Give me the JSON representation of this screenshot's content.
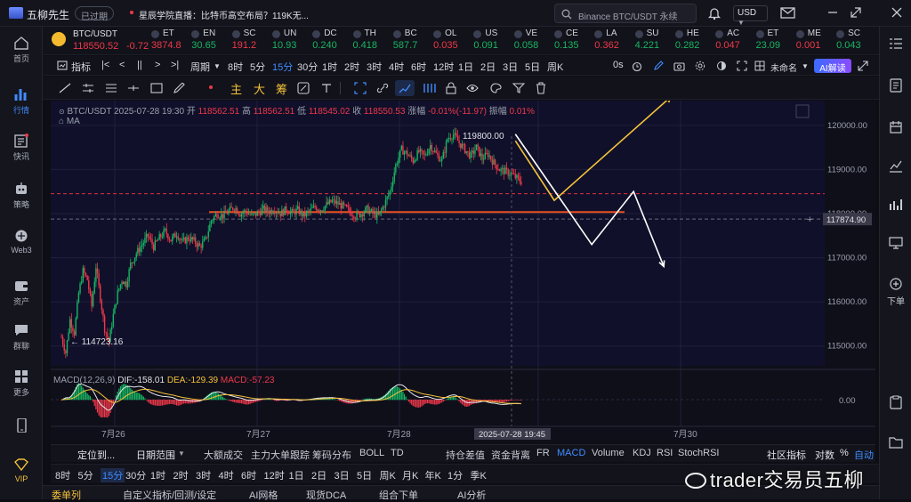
{
  "app": {
    "title": "五柳先生",
    "status_badge": "已过期",
    "announcement": "星辰学院直播：比特币高空布局？119K无...",
    "search_placeholder": "Binance BTC/USDT 永续",
    "currency": "USD"
  },
  "left_nav": [
    {
      "label": "首页",
      "icon": "home-icon"
    },
    {
      "label": "行情",
      "icon": "chart-bars-icon",
      "active": true
    },
    {
      "label": "快讯",
      "icon": "news-icon"
    },
    {
      "label": "策略",
      "icon": "robot-icon"
    },
    {
      "label": "Web3",
      "icon": "web3-icon"
    },
    {
      "label": "资产",
      "icon": "wallet-icon"
    },
    {
      "label": "群聊",
      "icon": "chat-icon"
    },
    {
      "label": "更多",
      "icon": "grid-icon"
    },
    {
      "label": "",
      "icon": "phone-icon"
    },
    {
      "label": "VIP",
      "icon": "vip-icon"
    }
  ],
  "right_nav": {
    "download_label": "下单"
  },
  "ticker_strip": {
    "main": {
      "symbol": "BTC/USDT",
      "price": "118550.52",
      "change": "-0.72"
    },
    "items": [
      {
        "name": "ET",
        "value": "3874.8"
      },
      {
        "name": "EN",
        "value": "30.65"
      },
      {
        "name": "SC",
        "value": "191.2"
      },
      {
        "name": "UN",
        "value": "10.93"
      },
      {
        "name": "DC",
        "value": "0.240"
      },
      {
        "name": "TH",
        "value": "0.418"
      },
      {
        "name": "BC",
        "value": "587.7"
      },
      {
        "name": "OL",
        "value": "0.035"
      },
      {
        "name": "US",
        "value": "0.091"
      },
      {
        "name": "VE",
        "value": "0.058"
      },
      {
        "name": "CE",
        "value": "0.135"
      },
      {
        "name": "LA",
        "value": "0.362"
      },
      {
        "name": "SU",
        "value": "4.221"
      },
      {
        "name": "HE",
        "value": "0.282"
      },
      {
        "name": "AC",
        "value": "0.047"
      },
      {
        "name": "ET",
        "value": "23.09"
      },
      {
        "name": "ME",
        "value": "0.001"
      },
      {
        "name": "SC",
        "value": "0.043"
      }
    ]
  },
  "toolbar_periods": {
    "indicator_label": "指标",
    "period_label": "周期",
    "periods": [
      "8时",
      "5分",
      "15分",
      "30分",
      "1时",
      "2时",
      "3时",
      "4时",
      "6时",
      "12时",
      "1日",
      "2日",
      "3日",
      "5日",
      "周K"
    ],
    "active_period": "15分",
    "countdown": "0s",
    "layout_name": "未命名",
    "ai_button": "AI解读"
  },
  "drawing_tools": {
    "labels": [
      "主",
      "大",
      "筹"
    ]
  },
  "chart_header": {
    "symbol": "BTC/USDT",
    "datetime": "2025-07-28 19:30",
    "open_label": "开",
    "open": "118562.51",
    "high_label": "高",
    "high": "118562.51",
    "low_label": "低",
    "low": "118545.02",
    "close_label": "收",
    "close": "118550.53",
    "change_label": "涨幅",
    "change": "-0.01%(-11.97)",
    "amp_label": "振幅",
    "amp": "0.01%",
    "ma_label": "MA"
  },
  "chart_data": {
    "type": "candlestick",
    "y_axis_ticks": [
      "120000.00",
      "119000.00",
      "118000.00",
      "117000.00",
      "116000.00",
      "115000.00"
    ],
    "y_range": [
      114550,
      120400
    ],
    "x_axis_ticks": [
      "7月26",
      "7月27",
      "7月28",
      "7月30"
    ],
    "crosshair_x_label": "2025-07-28 19:45",
    "crosshair_price_label": "117874.90",
    "annotations": {
      "high_label": "119800.00",
      "low_label": "114723.16"
    },
    "price_path": [
      [
        0,
        115200
      ],
      [
        3,
        114850
      ],
      [
        6,
        115600
      ],
      [
        9,
        115300
      ],
      [
        12,
        116200
      ],
      [
        15,
        116700
      ],
      [
        18,
        116500
      ],
      [
        21,
        115900
      ],
      [
        24,
        116800
      ],
      [
        27,
        116100
      ],
      [
        30,
        115400
      ],
      [
        33,
        115100
      ],
      [
        36,
        115700
      ],
      [
        39,
        116200
      ],
      [
        42,
        116500
      ],
      [
        45,
        116400
      ],
      [
        48,
        116850
      ],
      [
        52,
        117100
      ],
      [
        56,
        117300
      ],
      [
        60,
        117500
      ],
      [
        64,
        117250
      ],
      [
        68,
        117450
      ],
      [
        72,
        117600
      ],
      [
        76,
        117400
      ],
      [
        80,
        117550
      ],
      [
        84,
        117350
      ],
      [
        88,
        117450
      ],
      [
        92,
        117380
      ],
      [
        96,
        117250
      ],
      [
        100,
        117400
      ],
      [
        104,
        117850
      ],
      [
        108,
        118000
      ],
      [
        112,
        117950
      ],
      [
        116,
        118050
      ],
      [
        120,
        118150
      ],
      [
        124,
        118000
      ],
      [
        128,
        118050
      ],
      [
        132,
        117950
      ],
      [
        136,
        118000
      ],
      [
        140,
        118100
      ],
      [
        144,
        118050
      ],
      [
        148,
        118100
      ],
      [
        152,
        118000
      ],
      [
        156,
        118100
      ],
      [
        160,
        118020
      ],
      [
        164,
        118080
      ],
      [
        168,
        117950
      ],
      [
        172,
        118050
      ],
      [
        176,
        118150
      ],
      [
        180,
        118100
      ],
      [
        184,
        118200
      ],
      [
        188,
        118280
      ],
      [
        192,
        118220
      ],
      [
        196,
        118150
      ],
      [
        200,
        118050
      ],
      [
        204,
        117950
      ],
      [
        208,
        118000
      ],
      [
        212,
        118100
      ],
      [
        216,
        118000
      ],
      [
        220,
        117950
      ],
      [
        224,
        118200
      ],
      [
        228,
        118500
      ],
      [
        232,
        119100
      ],
      [
        236,
        119450
      ],
      [
        240,
        119350
      ],
      [
        244,
        119200
      ],
      [
        248,
        119400
      ],
      [
        252,
        119300
      ],
      [
        256,
        119550
      ],
      [
        260,
        119350
      ],
      [
        264,
        119200
      ],
      [
        268,
        119700
      ],
      [
        272,
        119800
      ],
      [
        276,
        119600
      ],
      [
        280,
        119450
      ],
      [
        284,
        119300
      ],
      [
        288,
        119500
      ],
      [
        292,
        119250
      ],
      [
        296,
        119350
      ],
      [
        300,
        119150
      ],
      [
        304,
        119000
      ],
      [
        308,
        118950
      ],
      [
        312,
        118900
      ],
      [
        316,
        118800
      ],
      [
        320,
        118700
      ],
      [
        324,
        118600
      ],
      [
        328,
        118550
      ]
    ],
    "levels": [
      {
        "price": 118450,
        "color": "#e0303e",
        "style": "dashed"
      },
      {
        "price": 118035,
        "color": "#e85020",
        "style": "solid"
      },
      {
        "price": 117874.9,
        "color": "#6a6a7a",
        "style": "dashed"
      }
    ],
    "forecast_paths": [
      {
        "color": "#f4c23a",
        "points": [
          [
            315,
            119650
          ],
          [
            342,
            118300
          ],
          [
            423,
            120650
          ]
        ]
      },
      {
        "color": "#ffffff",
        "points": [
          [
            315,
            119800
          ],
          [
            368,
            117300
          ],
          [
            397,
            118500
          ],
          [
            418,
            116800
          ]
        ]
      }
    ]
  },
  "macd": {
    "label": "MACD(12,26,9)",
    "dif_label": "DIF:",
    "dif": "-158.01",
    "dea_label": "DEA:",
    "dea": "-129.39",
    "macd_label": "MACD:",
    "macd": "-57.23",
    "zero_label": "0.00"
  },
  "bottom_tools": {
    "locate": "定位到...",
    "date_range": "日期范围",
    "tabs": [
      "大额成交",
      "主力大单跟踪",
      "筹码分布",
      "BOLL",
      "TD",
      "持仓差值",
      "资金背离",
      "FR",
      "MACD",
      "Volume",
      "KDJ",
      "RSI",
      "StochRSI"
    ],
    "active_tab": "MACD",
    "right_items": [
      "社区指标",
      "对数",
      "%",
      "自动"
    ]
  },
  "bottom_periods": {
    "items": [
      "8时",
      "5分",
      "15分",
      "30分",
      "1时",
      "2时",
      "3时",
      "4时",
      "6时",
      "12时",
      "1日",
      "2日",
      "3日",
      "5日",
      "周K",
      "月K",
      "年K",
      "1分",
      "季K"
    ],
    "active": "15分"
  },
  "bottom_tabs": [
    "委单列",
    "自定义指标/回测/设定",
    "AI网格",
    "现货DCA",
    "组合下单",
    "AI分析"
  ],
  "watermark": "trader交易员五柳"
}
